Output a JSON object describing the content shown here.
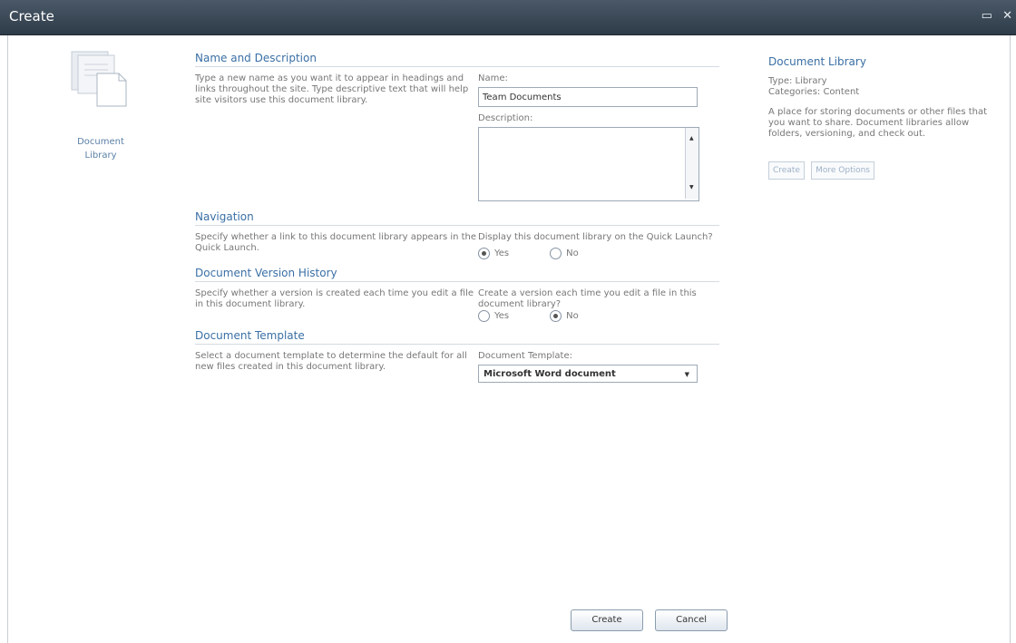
{
  "dialog": {
    "title": "Create",
    "icons": [
      "maximize-icon",
      "close-icon"
    ]
  },
  "left": {
    "icon": "document-library-icon",
    "label_line1": "Document",
    "label_line2": "Library"
  },
  "sections": {
    "name": {
      "heading": "Name and Description",
      "desc": "Type a new name as you want it to appear in headings and links throughout the site. Type descriptive text that will help site visitors use this document library.",
      "name_label": "Name:",
      "name_value": "Team Documents",
      "description_label": "Description:",
      "description_value": ""
    },
    "navigation": {
      "heading": "Navigation",
      "desc": "Specify whether a link to this document library appears in the Quick Launch.",
      "question": "Display this document library on the Quick Launch?",
      "yes": "Yes",
      "no": "No",
      "selected": "Yes"
    },
    "version": {
      "heading": "Document Version History",
      "desc": "Specify whether a version is created each time you edit a file in this document library.",
      "question": "Create a version each time you edit a file in this document library?",
      "yes": "Yes",
      "no": "No",
      "selected": "No"
    },
    "template": {
      "heading": "Document Template",
      "desc": "Select a document template to determine the default for all new files created in this document library.",
      "label": "Document Template:",
      "value": "Microsoft Word document"
    }
  },
  "right": {
    "title": "Document Library",
    "type": "Type: Library",
    "categories": "Categories: Content",
    "description": "A place for storing documents or other files that you want to share. Document libraries allow folders, versioning, and check out.",
    "create_label": "Create",
    "more_label": "More Options"
  },
  "buttons": {
    "create": "Create",
    "cancel": "Cancel"
  }
}
